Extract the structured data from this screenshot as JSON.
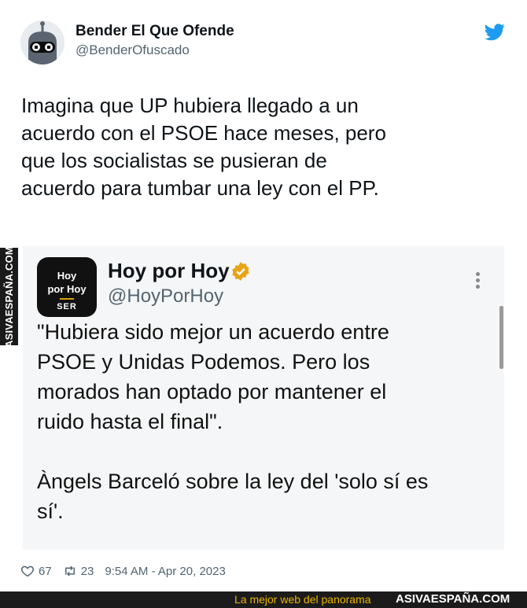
{
  "author": {
    "display_name": "Bender El Que Ofende",
    "handle": "@BenderOfuscado"
  },
  "tweet": {
    "lines": [
      "Imagina que UP hubiera llegado a un",
      "acuerdo con el PSOE hace meses, pero",
      "que los socialistas se pusieran de",
      "acuerdo para tumbar una ley con el PP."
    ]
  },
  "side_watermark": "ASIVAESPAÑA.COM",
  "quoted": {
    "avatar_line1": "Hoy",
    "avatar_line2": "por Hoy",
    "avatar_line3": "SER",
    "display_name": "Hoy por Hoy",
    "handle": "@HoyPorHoy",
    "paragraph1_lines": [
      "\"Hubiera sido mejor un acuerdo entre",
      "PSOE y Unidas Podemos. Pero los",
      "morados han optado por mantener el",
      "ruido hasta el final\"."
    ],
    "paragraph2_lines": [
      "Àngels Barceló sobre la ley del 'solo sí es",
      "sí'."
    ]
  },
  "meta": {
    "likes": "67",
    "retweets": "23",
    "timestamp": "9:54 AM - Apr 20, 2023"
  },
  "footer": {
    "slogan": "La mejor web del panorama",
    "brand": "ASIVAESPAÑA.COM"
  },
  "colors": {
    "twitter_blue": "#1d9bf0",
    "verified_gold": "#e8a317",
    "footer_slogan": "#e8b400"
  },
  "icons": [
    "bender-avatar",
    "twitter-bird-icon",
    "verified-badge-icon",
    "more-options-icon",
    "heart-icon",
    "retweet-icon"
  ]
}
